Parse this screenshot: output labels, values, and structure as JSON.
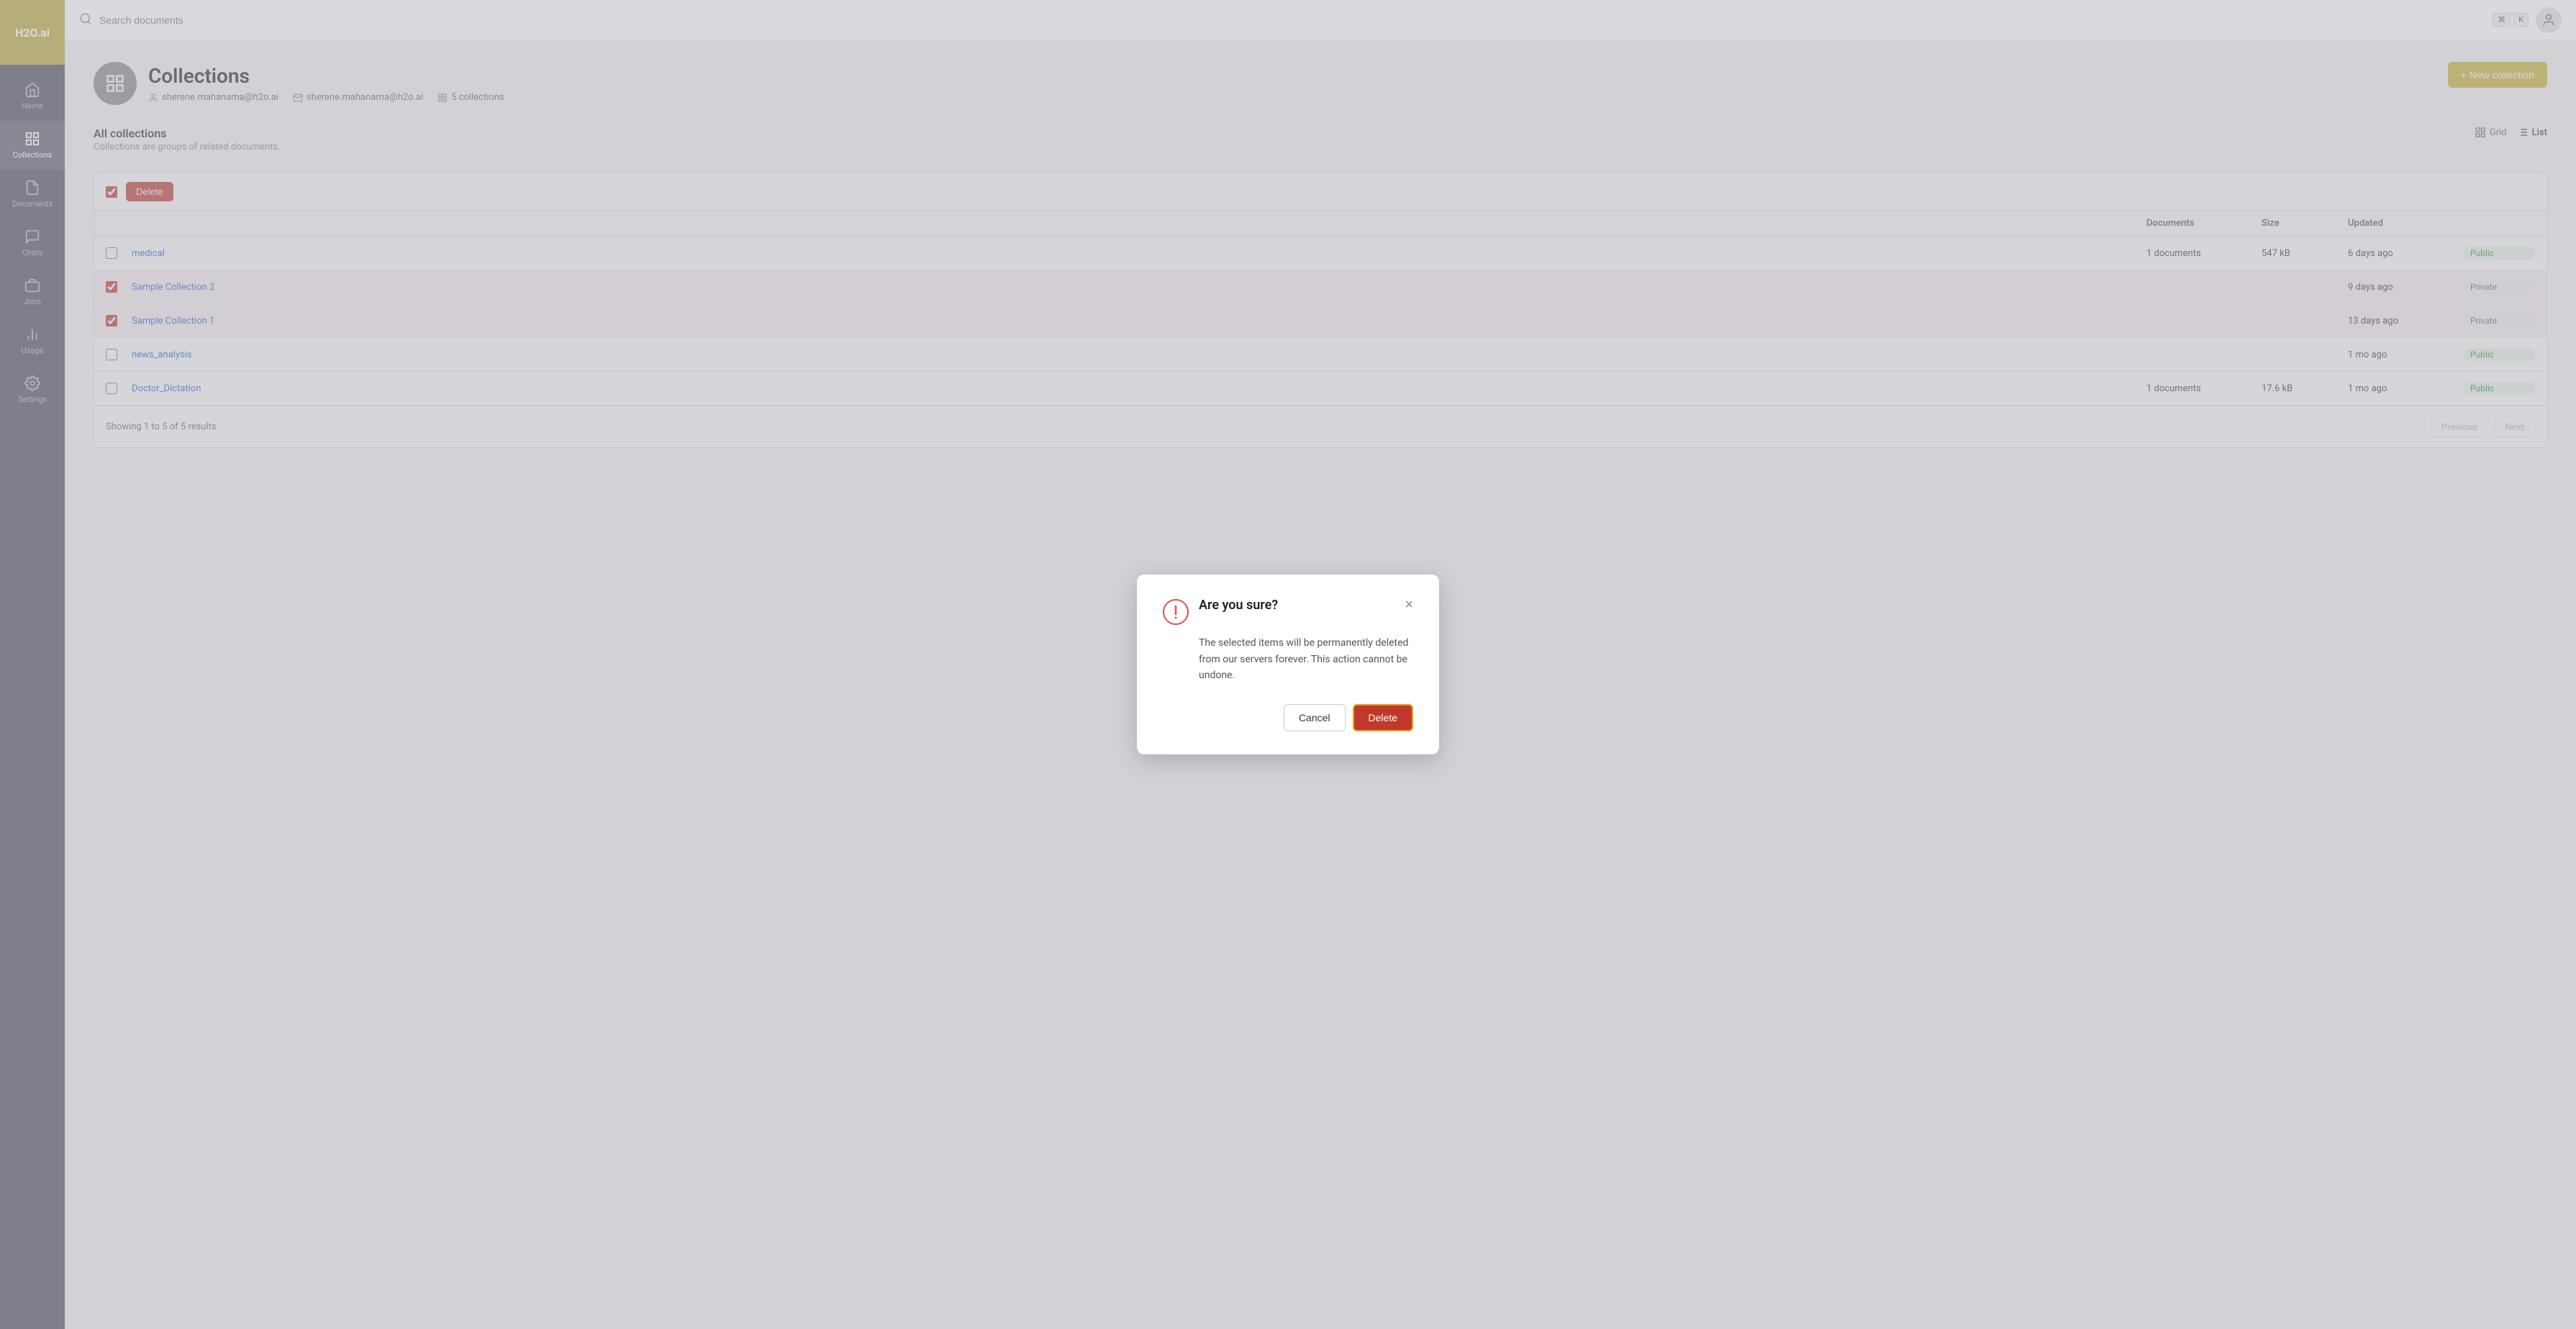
{
  "app": {
    "logo": "H2O.ai"
  },
  "sidebar": {
    "items": [
      {
        "id": "home",
        "label": "Home",
        "icon": "home"
      },
      {
        "id": "collections",
        "label": "Collections",
        "icon": "collections",
        "active": true
      },
      {
        "id": "documents",
        "label": "Documents",
        "icon": "documents"
      },
      {
        "id": "chats",
        "label": "Chats",
        "icon": "chats"
      },
      {
        "id": "jobs",
        "label": "Jobs",
        "icon": "jobs"
      },
      {
        "id": "usage",
        "label": "Usage",
        "icon": "usage"
      },
      {
        "id": "settings",
        "label": "Settings",
        "icon": "settings"
      }
    ]
  },
  "header": {
    "search_placeholder": "Search documents",
    "kbd1": "⌘",
    "kbd2": "K"
  },
  "page": {
    "title": "Collections",
    "user_name": "sherene.mahanama@h2o.ai",
    "user_email": "sherene.mahanama@h2o.ai",
    "collections_count": "5 collections",
    "new_collection_label": "+ New collection"
  },
  "all_collections": {
    "section_title": "All collections",
    "section_subtitle": "Collections are groups of related documents.",
    "view_grid": "Grid",
    "view_list": "List",
    "delete_btn": "Delete",
    "columns": {
      "name": "",
      "documents": "Documents",
      "size": "Size",
      "updated": "Updated",
      "visibility": ""
    },
    "rows": [
      {
        "id": 1,
        "name": "medical",
        "documents": "1 documents",
        "size": "547 kB",
        "updated": "6 days ago",
        "visibility": "Public",
        "selected": false
      },
      {
        "id": 2,
        "name": "Sample Collection 2",
        "documents": "",
        "size": "",
        "updated": "9 days ago",
        "visibility": "Private",
        "selected": true
      },
      {
        "id": 3,
        "name": "Sample Collection 1",
        "documents": "",
        "size": "",
        "updated": "13 days ago",
        "visibility": "Private",
        "selected": true
      },
      {
        "id": 4,
        "name": "news_analysis",
        "documents": "",
        "size": "",
        "updated": "1 mo ago",
        "visibility": "Public",
        "selected": false
      },
      {
        "id": 5,
        "name": "Doctor_Dictation",
        "documents": "1 documents",
        "size": "17.6 kB",
        "updated": "1 mo ago",
        "visibility": "Public",
        "selected": false
      }
    ],
    "footer": {
      "showing": "Showing 1 to 5 of 5 results",
      "prev": "Previous",
      "next": "Next"
    }
  },
  "modal": {
    "title": "Are you sure?",
    "body": "The selected items will be permanently deleted from our servers forever. This action cannot be undone.",
    "cancel_label": "Cancel",
    "delete_label": "Delete"
  }
}
